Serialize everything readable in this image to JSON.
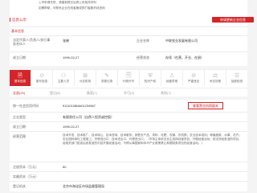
{
  "notice": {
    "line1": "上市申请失败，请重新提交后再上传相关材料",
    "line2": "如需帮助，可联系企业在线客服或拨打客服热线咨询"
  },
  "top_section": {
    "title": "信息公示",
    "action_label": "申请更新企业信息"
  },
  "basic_section": {
    "title": "基本信息",
    "rows": [
      {
        "label1": "法定代表人/负责人/执行事务合伙人",
        "value1": "张晓",
        "label2": "企业名称",
        "value2": "中联农业发展有限公司"
      },
      {
        "label1": "成立日期",
        "value1": "1999-02-27",
        "label2": "经营状态",
        "value2": "存续（在营、开业、在册）"
      }
    ]
  },
  "tabs": [
    {
      "label": "基本信息",
      "icon": "🗎",
      "active": true
    },
    {
      "label": "股东信息",
      "icon": "⊙",
      "active": false
    },
    {
      "label": "主要人员",
      "icon": "⚇",
      "active": false
    },
    {
      "label": "分支机构",
      "icon": "⊞",
      "active": false
    },
    {
      "label": "变更记录",
      "icon": "✎",
      "active": false
    },
    {
      "label": "行政许可",
      "icon": "🗐",
      "active": false
    },
    {
      "label": "知识产权",
      "icon": "⛨",
      "active": false
    },
    {
      "label": "经营异常",
      "icon": "⚠",
      "active": false
    },
    {
      "label": "严重违法",
      "icon": "⊘",
      "active": false
    },
    {
      "label": "司法协助",
      "icon": "⚖",
      "active": false
    },
    {
      "label": "抽查检查",
      "icon": "☰",
      "active": false
    }
  ],
  "filters": [
    "全部(25)",
    "登记(8)",
    "备案(7)",
    "许可(3)",
    "其他(7)"
  ],
  "detail": {
    "title_label": "统一社会信用代码",
    "title_value": "91110108MA01234567",
    "view_button": "查看营业执照副本",
    "rows": [
      {
        "label": "企业类型",
        "value": "有限责任公司（自然人投资或控股）"
      },
      {
        "label": "成立日期",
        "value": "1999-02-27"
      },
      {
        "label": "经营范围",
        "value": ""
      }
    ],
    "scope_text": "技术开发、技术推广、技术转让、技术咨询、技术服务；销售农产品、饲料、化肥、农膜、农机具；农业技术培训；种植蔬菜、水果、花卉；农业园林绿化工程施工；货物进出口、技术进出口、代理进出口。（市场主体依法自主选择经营项目，开展经营活动；依法须经批准的项目，经相关部门批准后依批准的内容开展经营活动；不得从事国家和本市产业政策禁止和限制类项目的经营活动。）",
    "bottom_rows": [
      {
        "label": "注册资本（万元）",
        "value": "50"
      },
      {
        "label": "实缴资本（万元）",
        "value": ""
      },
      {
        "label": "登记机关",
        "value": "北京市海淀区市场监督管理局"
      }
    ]
  },
  "colors": {
    "accent": "#d3262b",
    "bg": "#f4f4f4"
  }
}
